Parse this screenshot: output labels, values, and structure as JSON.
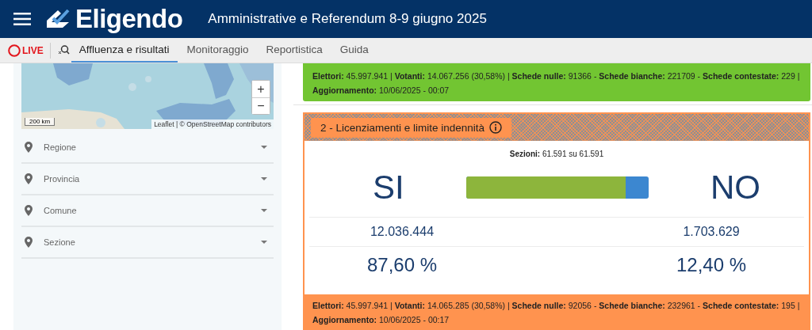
{
  "header": {
    "logo_text": "Eligendo",
    "title": "Amministrative e Referendum 8-9 giugno 2025"
  },
  "nav": {
    "live_label": "LIVE",
    "tabs": [
      {
        "label": "Affluenza e risultati",
        "selected": true
      },
      {
        "label": "Monitoraggio",
        "selected": false
      },
      {
        "label": "Reportistica",
        "selected": false
      },
      {
        "label": "Guida",
        "selected": false
      }
    ]
  },
  "sidebar": {
    "map": {
      "kind": "picture",
      "zoom_in": "+",
      "zoom_out": "−",
      "scale": "200 km",
      "attribution": "Leaflet | © OpenStreetMap contributors"
    },
    "filters": [
      {
        "label": "Regione"
      },
      {
        "label": "Provincia"
      },
      {
        "label": "Comune"
      },
      {
        "label": "Sezione"
      }
    ]
  },
  "cards": [
    {
      "kind": "summary",
      "color": "#72c532",
      "stats": "**Elettori:** 45.997.941 | **Votanti:** 14.067.256 (30,58%) | **Schede nulle:** 91366 - **Schede bianche:** 221709 - **Schede contestate:** 229 |",
      "updated": "**Aggiornamento:** 10/06/2025 - 00:07"
    },
    {
      "kind": "result",
      "color": "#ff934f",
      "title": "2 - Licenziamenti e limite indennità",
      "sections": "**Sezioni:** 61.591 su 61.591",
      "yes_label": "SI",
      "no_label": "NO",
      "level": 0.876,
      "yes_votes": "12.036.444",
      "no_votes": "1.703.629",
      "yes_percent": "87,60 %",
      "no_percent": "12,40 %",
      "stats": "**Elettori:** 45.997.941 | **Votanti:** 14.065.285 (30,58%) | **Schede nulle:** 92056 - **Schede bianche:** 232961 - **Schede contestate:** 195 |",
      "updated": "**Aggiornamento:** 10/06/2025 - 00:17"
    }
  ]
}
